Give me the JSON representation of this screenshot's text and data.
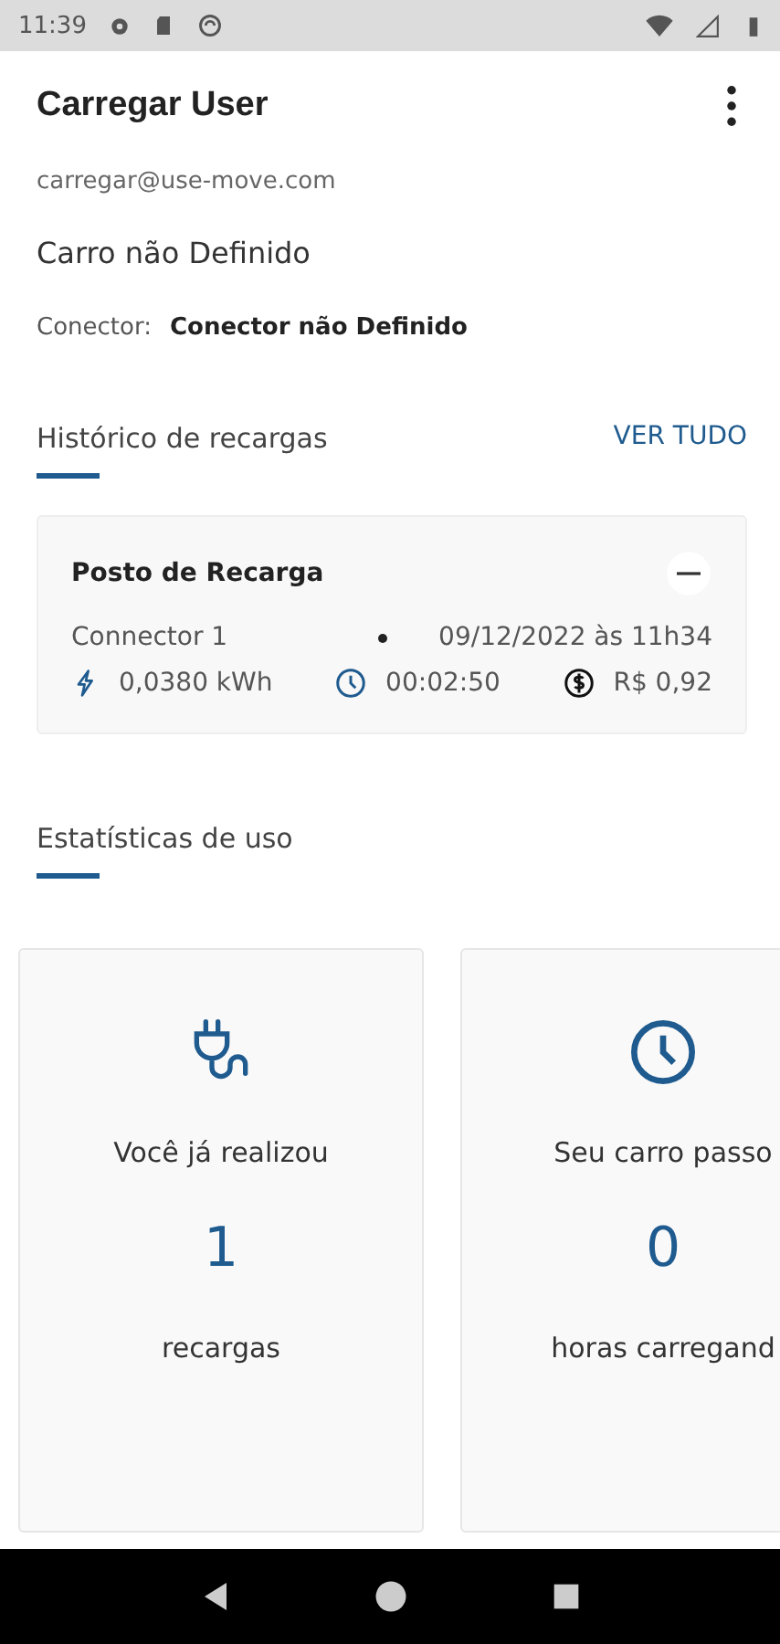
{
  "status_bar": {
    "time": "11:39"
  },
  "header": {
    "title": "Carregar User"
  },
  "profile": {
    "email": "carregar@use-move.com",
    "car": "Carro não Definido",
    "connector_label": "Conector:",
    "connector_value": "Conector não Definido"
  },
  "history": {
    "title": "Histórico de recargas",
    "action": "VER TUDO",
    "card": {
      "station": "Posto de Recarga",
      "connector": "Connector 1",
      "date": "09/12/2022 às 11h34",
      "energy": "0,0380 kWh",
      "duration": "00:02:50",
      "price": "R$ 0,92"
    }
  },
  "stats": {
    "title": "Estatísticas de uso",
    "cards": [
      {
        "kind": "plug",
        "caption": "Você já realizou",
        "value": "1",
        "unit": "recargas"
      },
      {
        "kind": "clock",
        "caption": "Seu carro passo",
        "value": "0",
        "unit": "horas carregand"
      }
    ]
  }
}
